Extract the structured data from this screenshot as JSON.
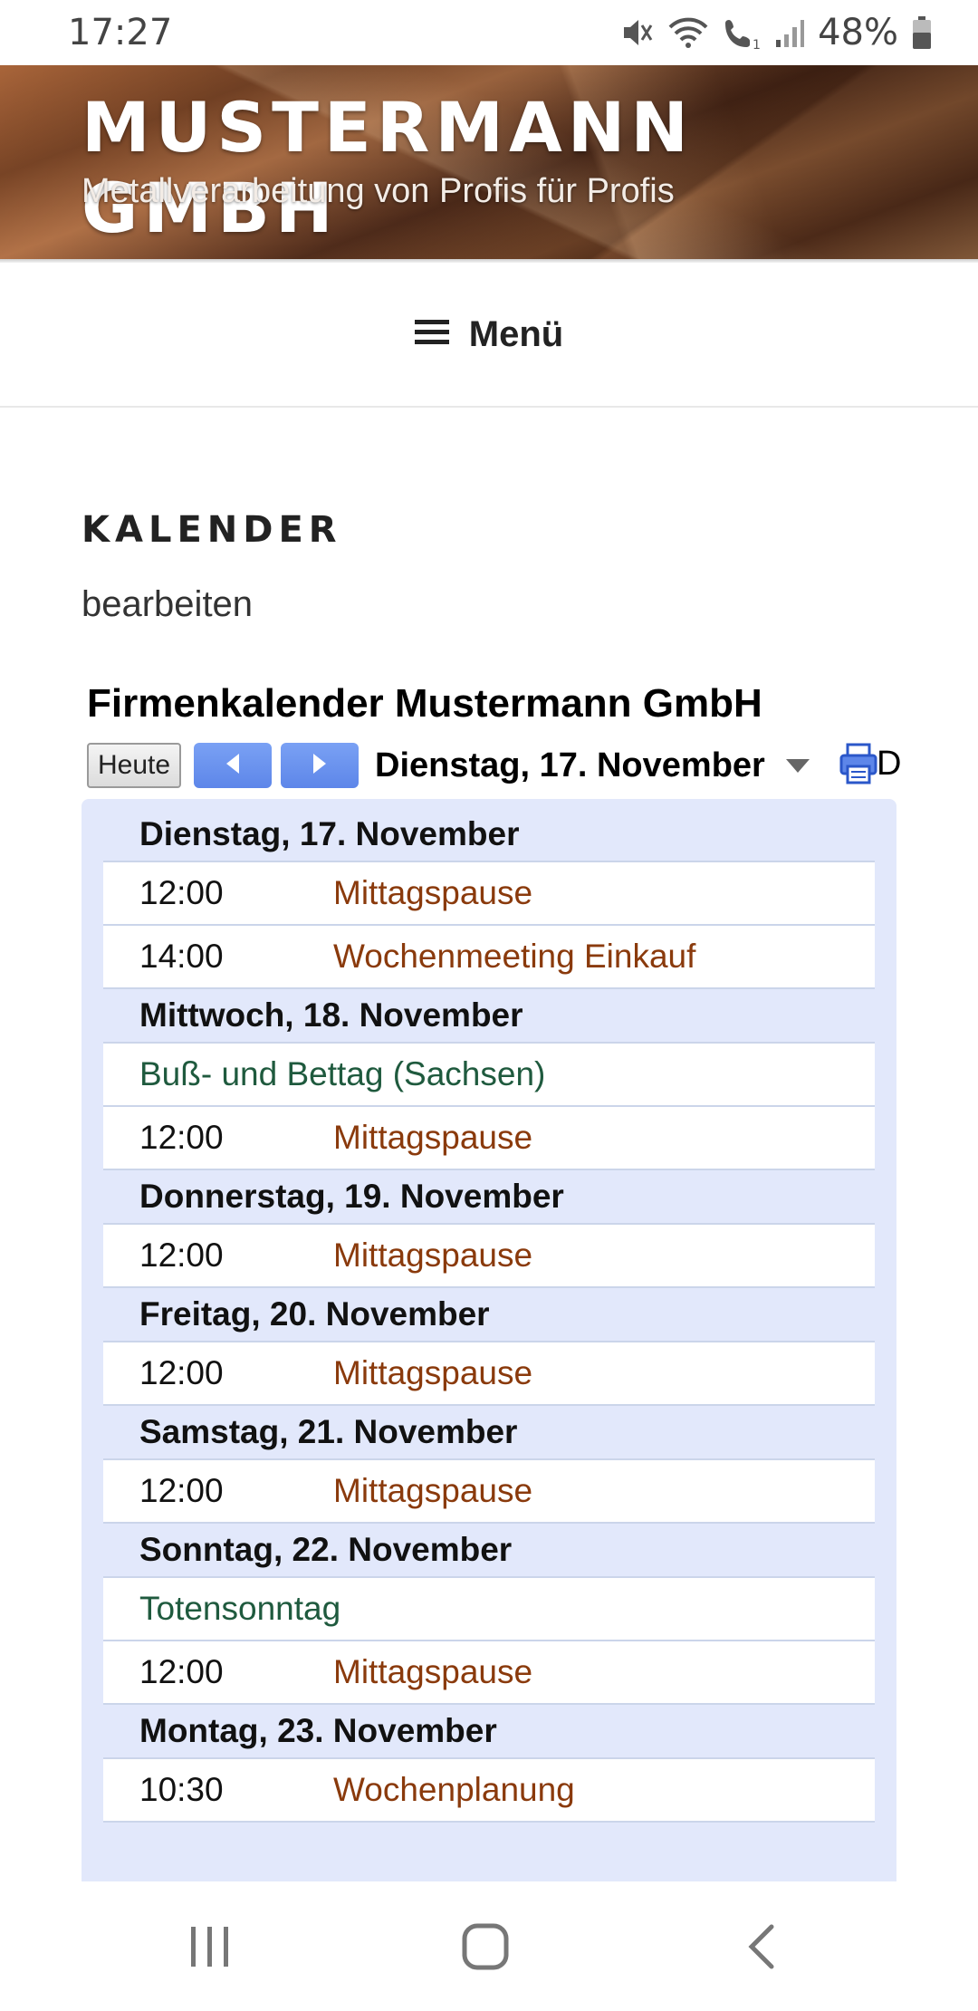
{
  "status_bar": {
    "time": "17:27",
    "battery": "48%",
    "icons": [
      "mute-icon",
      "wifi-icon",
      "wifi-calling-icon",
      "signal-icon",
      "battery-icon"
    ]
  },
  "header": {
    "title": "MUSTERMANN GMBH",
    "tagline": "Metallverarbeitung von Profis für Profis"
  },
  "menu": {
    "label": "Menü",
    "icon": "hamburger-icon"
  },
  "page": {
    "title": "KALENDER",
    "edit_link": "bearbeiten"
  },
  "calendar": {
    "title": "Firmenkalender Mustermann GmbH",
    "today_button": "Heute",
    "current_date": "Dienstag, 17. November",
    "truncated_text": "D",
    "colors": {
      "event_title": "#8a3a0c",
      "allday_title": "#1f5a3e",
      "agenda_bg": "#e2e8fb",
      "nav_button": "#5d86e9"
    },
    "days": [
      {
        "label": "Dienstag, 17. November",
        "events": [
          {
            "time": "12:00",
            "title": "Mittagspause"
          },
          {
            "time": "14:00",
            "title": "Wochenmeeting Einkauf"
          }
        ]
      },
      {
        "label": "Mittwoch, 18. November",
        "events": [
          {
            "allday": "Buß- und Bettag (Sachsen)"
          },
          {
            "time": "12:00",
            "title": "Mittagspause"
          }
        ]
      },
      {
        "label": "Donnerstag, 19. November",
        "events": [
          {
            "time": "12:00",
            "title": "Mittagspause"
          }
        ]
      },
      {
        "label": "Freitag, 20. November",
        "events": [
          {
            "time": "12:00",
            "title": "Mittagspause"
          }
        ]
      },
      {
        "label": "Samstag, 21. November",
        "events": [
          {
            "time": "12:00",
            "title": "Mittagspause"
          }
        ]
      },
      {
        "label": "Sonntag, 22. November",
        "events": [
          {
            "allday": "Totensonntag"
          },
          {
            "time": "12:00",
            "title": "Mittagspause"
          }
        ]
      },
      {
        "label": "Montag, 23. November",
        "events": [
          {
            "time": "10:30",
            "title": "Wochenplanung"
          }
        ]
      }
    ]
  },
  "bottom_nav": {
    "icons": [
      "recent-apps-icon",
      "home-icon",
      "back-icon"
    ]
  }
}
